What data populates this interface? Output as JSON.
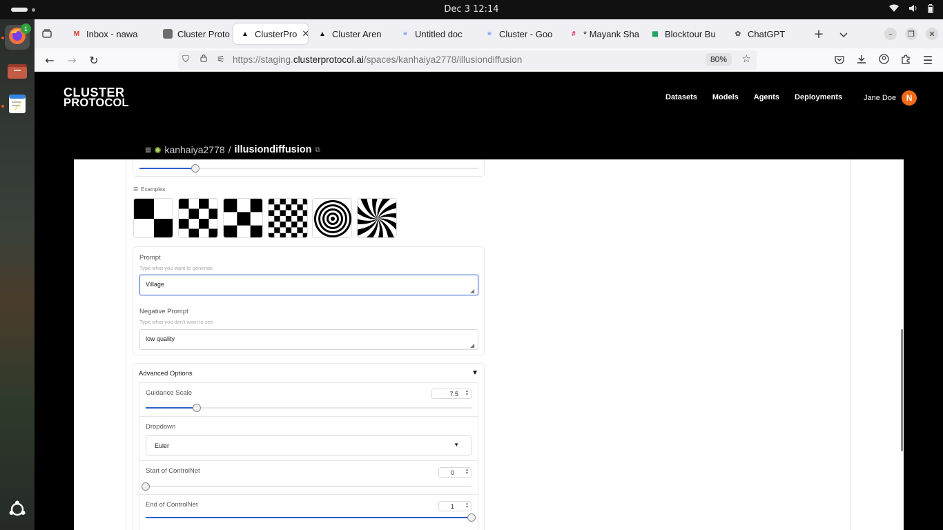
{
  "system": {
    "clock": "Dec 3  12:14",
    "dock_badge": "1"
  },
  "browser": {
    "tabs": [
      {
        "label": "Inbox - nawa",
        "icon": "gmail-icon",
        "color": "#d93025",
        "glyph": "M"
      },
      {
        "label": "Cluster Proto",
        "icon": "cluster-icon",
        "color": "#6d6d6d",
        "glyph": ""
      },
      {
        "label": "ClusterPro",
        "icon": "cluster-icon",
        "color": "#111",
        "glyph": "▲",
        "active": true
      },
      {
        "label": "Cluster Aren",
        "icon": "cluster-icon",
        "color": "#111",
        "glyph": "▲"
      },
      {
        "label": "Untitled doc",
        "icon": "docs-icon",
        "color": "#4285f4",
        "glyph": "≡"
      },
      {
        "label": "Cluster - Goo",
        "icon": "docs-icon",
        "color": "#4285f4",
        "glyph": "≡"
      },
      {
        "label": "* Mayank Sha",
        "icon": "slack-icon",
        "color": "#e01e5a",
        "glyph": "#"
      },
      {
        "label": "Blocktour Bu",
        "icon": "sheets-icon",
        "color": "#0f9d58",
        "glyph": "▦"
      },
      {
        "label": "ChatGPT",
        "icon": "chatgpt-icon",
        "color": "#555",
        "glyph": "✿"
      }
    ],
    "url_prefix": "https://staging.",
    "url_domain": "clusterprotocol.ai",
    "url_path": "/spaces/kanhaiya2778/illusiondiffusion",
    "zoom": "80%"
  },
  "site": {
    "logo_line1": "CLUSTER",
    "logo_line2": "PROTOCOL",
    "nav": [
      "Datasets",
      "Models",
      "Agents",
      "Deployments"
    ],
    "user_name": "Jane Doe",
    "user_initial": "N",
    "space_owner": "kanhaiya2778",
    "space_slash": "/",
    "space_name": "illusiondiffusion"
  },
  "app": {
    "top_slider_value": 0.165,
    "examples_label": "Examples",
    "examples": [
      "checker-2x2",
      "checker-4x4",
      "checker-3x3",
      "checker-6x6",
      "spiral",
      "swirl"
    ],
    "prompt_label": "Prompt",
    "prompt_hint": "Type what you want to generate",
    "prompt_value": "Village",
    "negative_label": "Negative Prompt",
    "negative_hint": "Type what you don't want to see",
    "negative_value": "low quality",
    "advanced_label": "Advanced Options",
    "advanced_toggle": "▼",
    "guidance_label": "Guidance Scale",
    "guidance_value": "7.5",
    "guidance_fraction": 0.157,
    "dropdown_label": "Dropdown",
    "dropdown_value": "Euler",
    "start_label": "Start of ControlNet",
    "start_value": "0",
    "start_fraction": 0,
    "end_label": "End of ControlNet",
    "end_value": "1",
    "end_fraction": 1
  }
}
